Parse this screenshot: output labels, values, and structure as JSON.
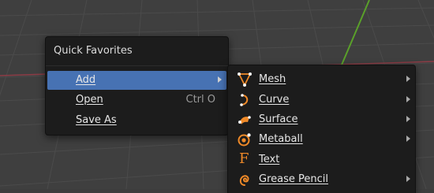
{
  "quick_menu": {
    "title": "Quick Favorites",
    "items": [
      {
        "label": "Add",
        "highlighted": true,
        "submenu": true
      },
      {
        "label": "Open",
        "shortcut": "Ctrl O"
      },
      {
        "label": "Save As"
      }
    ]
  },
  "add_menu": {
    "items": [
      {
        "label": "Mesh",
        "icon": "mesh-icon",
        "submenu": true
      },
      {
        "label": "Curve",
        "icon": "curve-icon",
        "submenu": true
      },
      {
        "label": "Surface",
        "icon": "surface-icon",
        "submenu": true
      },
      {
        "label": "Metaball",
        "icon": "metaball-icon",
        "submenu": true
      },
      {
        "label": "Text",
        "icon": "text-icon",
        "submenu": false
      },
      {
        "label": "Grease Pencil",
        "icon": "grease-pencil-icon",
        "submenu": true
      }
    ]
  },
  "colors": {
    "highlight": "#4772b3",
    "menu_bg": "#1c1c1c",
    "icon_orange": "#f08a28",
    "axis_red": "#8c3c46",
    "axis_green": "#5aa02a"
  }
}
